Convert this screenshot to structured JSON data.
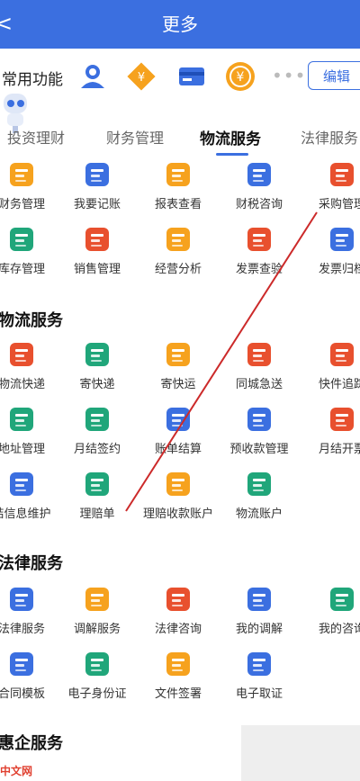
{
  "header": {
    "title": "更多",
    "back_glyph": "<"
  },
  "common": {
    "label": "常用功能",
    "more_glyph": "•••",
    "edit_label": "编辑",
    "icons": [
      "user-service-icon",
      "diamond-coin-icon",
      "card-icon",
      "yen-coin-icon"
    ]
  },
  "tabs": [
    "投资理财",
    "财务管理",
    "物流服务",
    "法律服务"
  ],
  "active_tab": "物流服务",
  "finance_grid": [
    {
      "label": "财务管理",
      "icon": "yen-doc-icon",
      "color": "#f6a21e"
    },
    {
      "label": "我要记账",
      "icon": "ledger-icon",
      "color": "#3b6fe0"
    },
    {
      "label": "报表查看",
      "icon": "report-icon",
      "color": "#f6a21e"
    },
    {
      "label": "财税咨询",
      "icon": "yen-circle-icon",
      "color": "#3b6fe0"
    },
    {
      "label": "采购管理",
      "icon": "cart-icon",
      "color": "#e8502e"
    },
    {
      "label": "库存管理",
      "icon": "warehouse-icon",
      "color": "#20a67a"
    },
    {
      "label": "销售管理",
      "icon": "shop-icon",
      "color": "#e8502e"
    },
    {
      "label": "经营分析",
      "icon": "calendar-chart-icon",
      "color": "#f6a21e"
    },
    {
      "label": "发票查验",
      "icon": "invoice-icon",
      "color": "#e8502e"
    },
    {
      "label": "发票归档",
      "icon": "archive-icon",
      "color": "#3b6fe0"
    }
  ],
  "logistics": {
    "title": "物流服务",
    "items": [
      {
        "label": "物流快递",
        "icon": "truck-icon",
        "color": "#e8502e"
      },
      {
        "label": "寄快递",
        "icon": "box-icon",
        "color": "#20a67a"
      },
      {
        "label": "寄快运",
        "icon": "freight-icon",
        "color": "#f6a21e"
      },
      {
        "label": "同城急送",
        "icon": "building-icon",
        "color": "#e8502e"
      },
      {
        "label": "快件追踪",
        "icon": "wallet-icon",
        "color": "#e8502e"
      },
      {
        "label": "地址管理",
        "icon": "address-icon",
        "color": "#20a67a"
      },
      {
        "label": "月结签约",
        "icon": "handshake-icon",
        "color": "#20a67a"
      },
      {
        "label": "账单结算",
        "icon": "bill-icon",
        "color": "#3b6fe0"
      },
      {
        "label": "预收款管理",
        "icon": "prepay-icon",
        "color": "#3b6fe0"
      },
      {
        "label": "月结开票",
        "icon": "printer-icon",
        "color": "#e8502e"
      },
      {
        "label": "结信息维护",
        "icon": "maintain-icon",
        "color": "#3b6fe0"
      },
      {
        "label": "理赔单",
        "icon": "shield-yen-icon",
        "color": "#20a67a"
      },
      {
        "label": "理赔收款账户",
        "icon": "claim-account-icon",
        "color": "#f6a21e"
      },
      {
        "label": "物流账户",
        "icon": "person-account-icon",
        "color": "#20a67a"
      }
    ]
  },
  "legal": {
    "title": "法律服务",
    "items": [
      {
        "label": "法律服务",
        "icon": "gavel-icon",
        "color": "#3b6fe0"
      },
      {
        "label": "调解服务",
        "icon": "mediation-icon",
        "color": "#f6a21e"
      },
      {
        "label": "法律咨询",
        "icon": "chat-icon",
        "color": "#e8502e"
      },
      {
        "label": "我的调解",
        "icon": "people-icon",
        "color": "#3b6fe0"
      },
      {
        "label": "我的咨询",
        "icon": "person-chat-icon",
        "color": "#20a67a"
      },
      {
        "label": "合同模板",
        "icon": "contract-icon",
        "color": "#3b6fe0"
      },
      {
        "label": "电子身份证",
        "icon": "id-card-icon",
        "color": "#20a67a"
      },
      {
        "label": "文件签署",
        "icon": "sign-icon",
        "color": "#f6a21e"
      },
      {
        "label": "电子取证",
        "icon": "camera-icon",
        "color": "#3b6fe0"
      }
    ]
  },
  "enterprise": {
    "title": "惠企服务"
  },
  "watermark": "中文网"
}
